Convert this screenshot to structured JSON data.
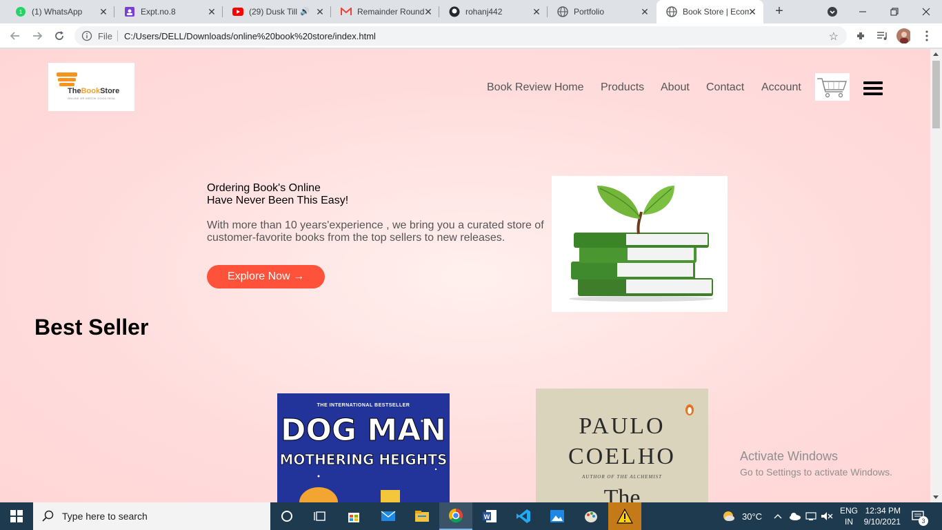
{
  "browser": {
    "tabs": [
      {
        "title": "(1) WhatsApp",
        "icon": "whatsapp-icon"
      },
      {
        "title": "Expt.no.8",
        "icon": "classroom-icon"
      },
      {
        "title": "(29) Dusk Till",
        "icon": "youtube-icon"
      },
      {
        "title": "Remainder Round",
        "icon": "gmail-icon"
      },
      {
        "title": "rohanj442",
        "icon": "github-icon"
      },
      {
        "title": "Portfolio",
        "icon": "globe-icon"
      },
      {
        "title": "Book Store | Ecom",
        "icon": "globe-icon",
        "active": true
      }
    ],
    "address": {
      "scheme_label": "File",
      "url": "C:/Users/DELL/Downloads/online%20book%20store/index.html"
    }
  },
  "page": {
    "logo": {
      "text_main": "The",
      "text_accent": "Book",
      "text_end": "Store",
      "tagline": "ONLINE OR EBOOK GOOD REAL"
    },
    "nav": [
      "Book Review Home",
      "Products",
      "About",
      "Contact",
      "Account"
    ],
    "hero": {
      "heading_line1": "Ordering Book's Online",
      "heading_line2": "Have Never Been This Easy!",
      "paragraph": "With more than 10 years'experience , we bring you a curated store of customer-favorite books from the top sellers to new releases.",
      "button": "Explore Now →"
    },
    "section_title": "Best Seller",
    "books": [
      {
        "line1": "THE INTERNATIONAL BESTSELLER",
        "line2": "DOG MAN",
        "line3": "MOTHERING HEIGHTS"
      },
      {
        "line1": "PAULO",
        "line2": "COELHO",
        "line3": "AUTHOR OF THE ALCHEMIST",
        "line4": "The"
      }
    ],
    "watermark": {
      "line1": "Activate Windows",
      "line2": "Go to Settings to activate Windows."
    }
  },
  "taskbar": {
    "search_placeholder": "Type here to search",
    "weather": "30°C",
    "lang_line1": "ENG",
    "lang_line2": "IN",
    "time": "12:34 PM",
    "date": "9/10/2021",
    "notifications": "3"
  },
  "colors": {
    "accent": "#ff523b",
    "page_bg": "#ffdcdc",
    "taskbar_bg": "#1d3a4f"
  }
}
